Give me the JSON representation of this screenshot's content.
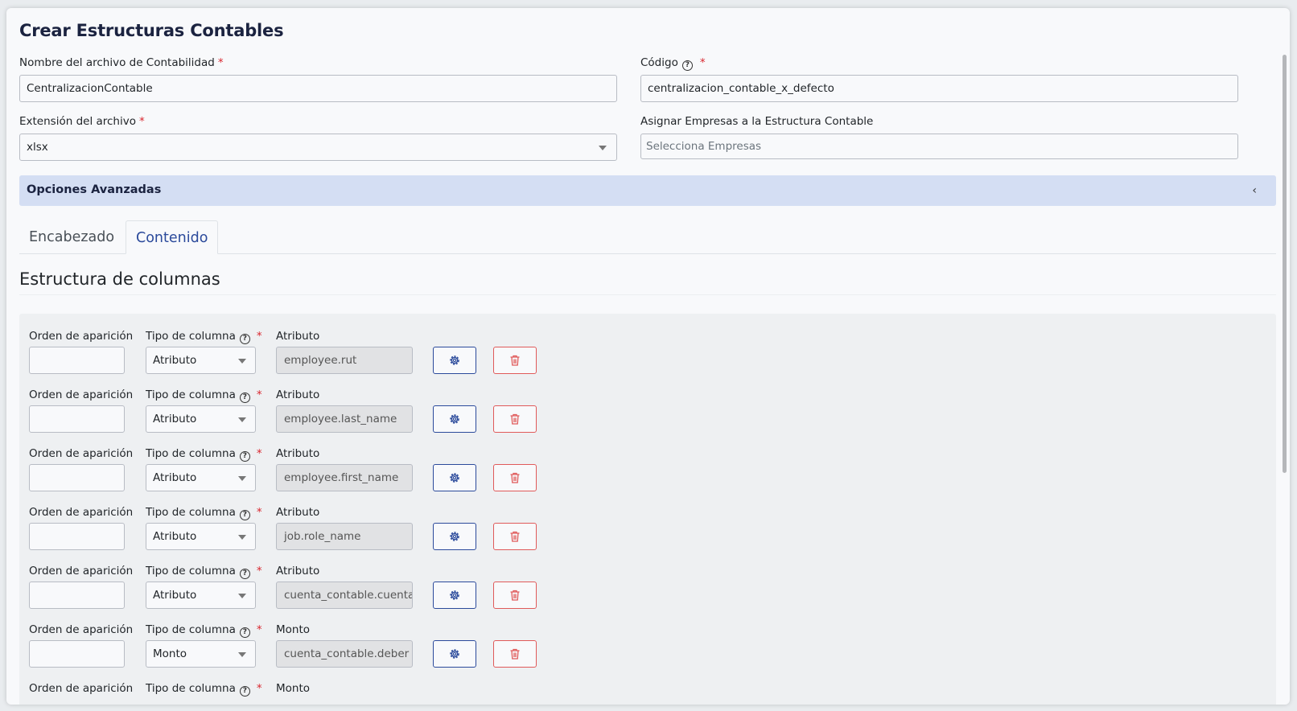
{
  "page": {
    "title": "Crear Estructuras Contables"
  },
  "form": {
    "nombre_label": "Nombre del archivo de Contabilidad",
    "nombre_value": "CentralizacionContable",
    "codigo_label": "Código",
    "codigo_value": "centralizacion_contable_x_defecto",
    "extension_label": "Extensión del archivo",
    "extension_value": "xlsx",
    "empresas_label": "Asignar Empresas a la Estructura Contable",
    "empresas_placeholder": "Selecciona Empresas",
    "required_mark": "*"
  },
  "advanced": {
    "title": "Opciones Avanzadas",
    "chevron": "‹"
  },
  "tabs": [
    {
      "label": "Encabezado",
      "active": false
    },
    {
      "label": "Contenido",
      "active": true
    }
  ],
  "section": {
    "title": "Estructura de columnas"
  },
  "columns": {
    "orden_label": "Orden de aparición",
    "tipo_label": "Tipo de columna",
    "rows": [
      {
        "orden": "",
        "tipo": "Atributo",
        "attr_label": "Atributo",
        "attr_value": "employee.rut"
      },
      {
        "orden": "",
        "tipo": "Atributo",
        "attr_label": "Atributo",
        "attr_value": "employee.last_name"
      },
      {
        "orden": "",
        "tipo": "Atributo",
        "attr_label": "Atributo",
        "attr_value": "employee.first_name"
      },
      {
        "orden": "",
        "tipo": "Atributo",
        "attr_label": "Atributo",
        "attr_value": "job.role_name"
      },
      {
        "orden": "",
        "tipo": "Atributo",
        "attr_label": "Atributo",
        "attr_value": "cuenta_contable.cuenta_"
      },
      {
        "orden": "",
        "tipo": "Monto",
        "attr_label": "Monto",
        "attr_value": "cuenta_contable.deber"
      },
      {
        "orden": "",
        "tipo": "",
        "attr_label": "Monto",
        "attr_value": ""
      }
    ]
  },
  "icons": {
    "help": "question-circle-icon",
    "gear": "gear-icon",
    "delete": "trash-icon",
    "dropdown": "caret-down-icon",
    "collapse": "chevron-left-icon"
  },
  "colors": {
    "primary": "#2b4a9b",
    "danger": "#e05a5a",
    "required": "#d9262e",
    "accordion_bg": "#d4def3"
  }
}
